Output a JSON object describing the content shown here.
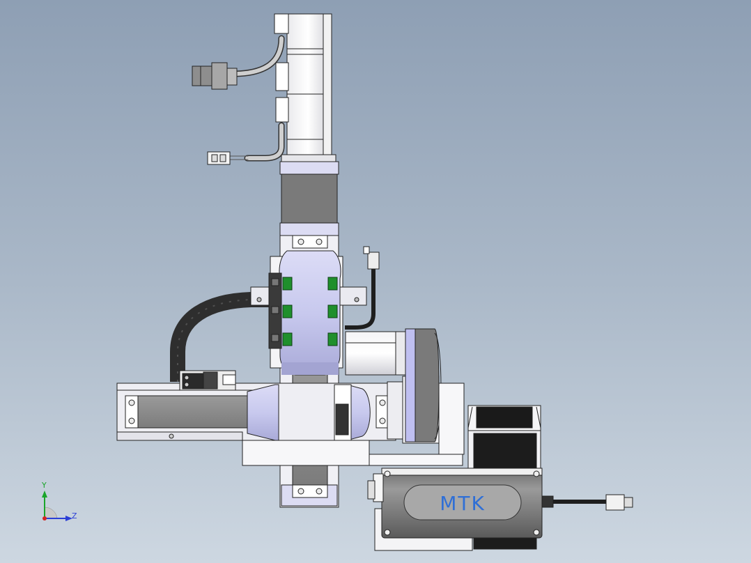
{
  "model": {
    "brand_label": "MTK"
  },
  "triad": {
    "axis_y": "Y",
    "axis_z": "Z"
  },
  "colors": {
    "background_top": "#8e9fb4",
    "background_bottom": "#cdd7e1",
    "carriage": "#c9cbf0",
    "motor_gray": "#7a7a7a",
    "rail_gray": "#8a8a8a",
    "cable_black": "#2e2e2e",
    "green_marker": "#1f8f2c",
    "brand_blue": "#2f6fd6",
    "axis_y_green": "#1aa52a",
    "axis_z_blue": "#2b3fd6",
    "axis_x_red": "#d22525"
  }
}
